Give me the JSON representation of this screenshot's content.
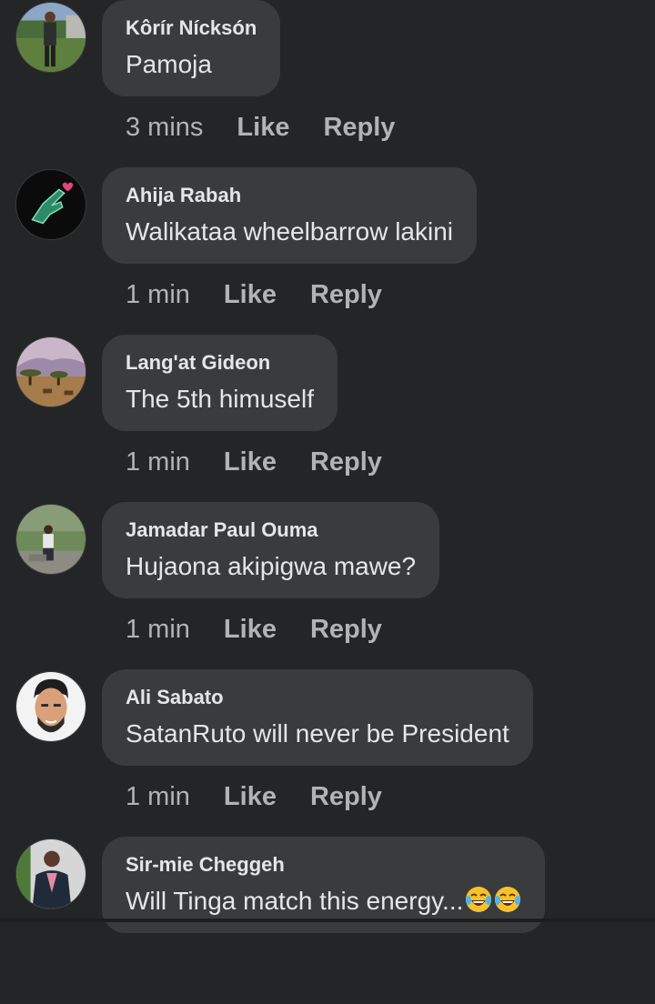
{
  "comments": [
    {
      "author": "Kôrír Nícksón",
      "text": "Pamoja",
      "time": "3 mins",
      "like": "Like",
      "reply": "Reply",
      "avatar": "man-standing-avatar"
    },
    {
      "author": "Ahija Rabah",
      "text": "Walikataa wheelbarrow lakini",
      "time": "1 min",
      "like": "Like",
      "reply": "Reply",
      "avatar": "hand-heart-avatar"
    },
    {
      "author": "Lang'at Gideon",
      "text": "The 5th himuself",
      "time": "1 min",
      "like": "Like",
      "reply": "Reply",
      "avatar": "savanna-landscape-avatar"
    },
    {
      "author": "Jamadar Paul Ouma",
      "text": "Hujaona akipigwa mawe?",
      "time": "1 min",
      "like": "Like",
      "reply": "Reply",
      "avatar": "man-sitting-avatar"
    },
    {
      "author": "Ali Sabato",
      "text": "SatanRuto will never be President",
      "time": "1 min",
      "like": "Like",
      "reply": "Reply",
      "avatar": "cartoon-face-avatar"
    },
    {
      "author": "Sir-mie Cheggeh",
      "text": "Will Tinga match this energy...",
      "time": "",
      "like": "",
      "reply": "",
      "avatar": "man-suit-avatar",
      "emojis": [
        "tears-of-joy-emoji",
        "tears-of-joy-emoji"
      ]
    }
  ]
}
